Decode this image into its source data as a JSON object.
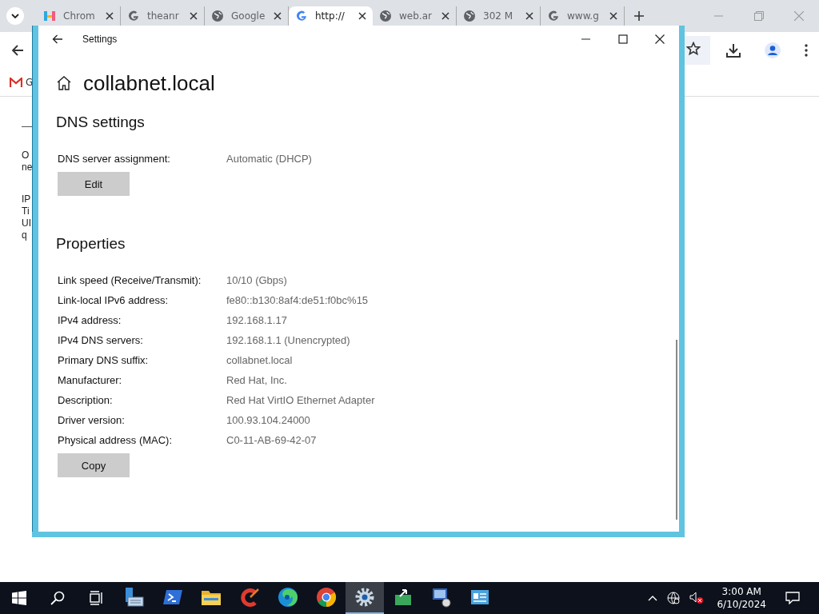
{
  "browser": {
    "tabs": [
      {
        "label": "Chrom",
        "kind": "hub",
        "selected": false
      },
      {
        "label": "theanr",
        "kind": "google",
        "selected": false
      },
      {
        "label": "Google",
        "kind": "globe",
        "selected": false
      },
      {
        "label": "http://",
        "kind": "google",
        "selected": true
      },
      {
        "label": "web.ar",
        "kind": "globe",
        "selected": false
      },
      {
        "label": "302 M",
        "kind": "globe",
        "selected": false
      },
      {
        "label": "www.g",
        "kind": "google",
        "selected": false
      }
    ],
    "bookmark": "G",
    "page_text": [
      [
        "O",
        "ne"
      ],
      [
        "IP",
        "Ti",
        "UI",
        "q"
      ]
    ]
  },
  "settings": {
    "title": "Settings",
    "heading": "collabnet.local",
    "sections": [
      {
        "title": "DNS settings",
        "button": "Edit",
        "rows": [
          {
            "label": "DNS server assignment:",
            "value": "Automatic (DHCP)"
          }
        ]
      },
      {
        "title": "Properties",
        "button": "Copy",
        "rows": [
          {
            "label": "Link speed (Receive/Transmit):",
            "value": "10/10 (Gbps)"
          },
          {
            "label": "Link-local IPv6 address:",
            "value": "fe80::b130:8af4:de51:f0bc%15"
          },
          {
            "label": "IPv4 address:",
            "value": "192.168.1.17"
          },
          {
            "label": "IPv4 DNS servers:",
            "value": "192.168.1.1 (Unencrypted)"
          },
          {
            "label": "Primary DNS suffix:",
            "value": "collabnet.local"
          },
          {
            "label": "Manufacturer:",
            "value": "Red Hat, Inc."
          },
          {
            "label": "Description:",
            "value": "Red Hat VirtIO Ethernet Adapter"
          },
          {
            "label": "Driver version:",
            "value": "100.93.104.24000"
          },
          {
            "label": "Physical address (MAC):",
            "value": "C0-11-AB-69-42-07"
          }
        ]
      }
    ]
  },
  "taskbar": {
    "apps": [
      {
        "kind": "server",
        "active": false
      },
      {
        "kind": "terminal",
        "active": false
      },
      {
        "kind": "folder",
        "active": false
      },
      {
        "kind": "cleaner",
        "active": false
      },
      {
        "kind": "edge",
        "active": false
      },
      {
        "kind": "chrome",
        "active": false
      },
      {
        "kind": "gear",
        "active": true
      },
      {
        "kind": "network",
        "active": false
      },
      {
        "kind": "monitor",
        "active": false
      },
      {
        "kind": "card",
        "active": false
      }
    ],
    "time": "3:00 AM",
    "date": "6/10/2024"
  }
}
